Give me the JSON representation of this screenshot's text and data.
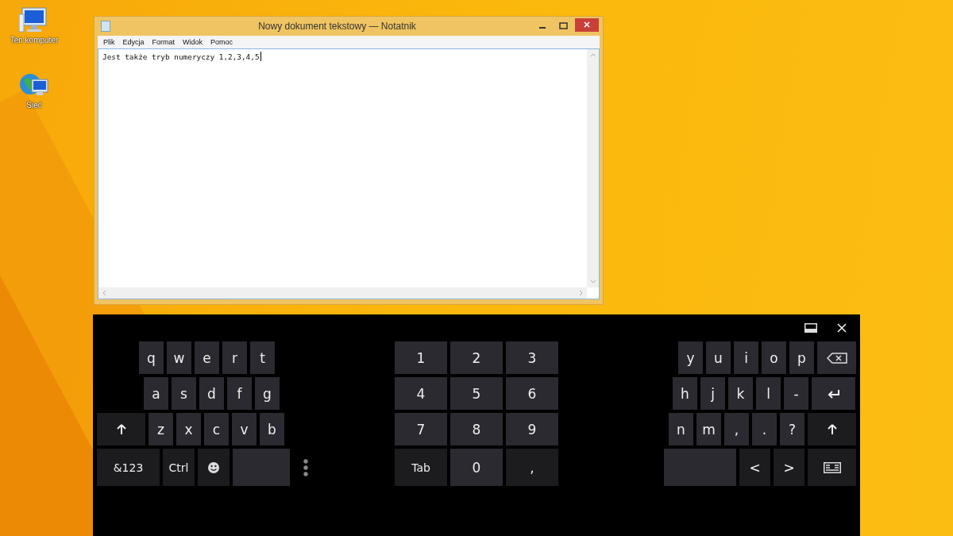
{
  "desktop": {
    "icons": [
      {
        "label": "Ten komputer",
        "kind": "computer"
      },
      {
        "label": "Sieć",
        "kind": "network"
      }
    ]
  },
  "notepad": {
    "title": "Nowy dokument tekstowy — Notatnik",
    "menu": [
      "Plik",
      "Edycja",
      "Format",
      "Widok",
      "Pomoc"
    ],
    "text": "Jest także tryb numeryczy 1,2,3,4,5"
  },
  "keyboard": {
    "sections": [
      {
        "rows": [
          [
            {
              "label": "q",
              "kind": "char"
            },
            {
              "label": "w",
              "kind": "char"
            },
            {
              "label": "e",
              "kind": "char"
            },
            {
              "label": "r",
              "kind": "char"
            },
            {
              "label": "t",
              "kind": "char"
            }
          ],
          [
            {
              "label": "a",
              "kind": "char"
            },
            {
              "label": "s",
              "kind": "char"
            },
            {
              "label": "d",
              "kind": "char"
            },
            {
              "label": "f",
              "kind": "char"
            },
            {
              "label": "g",
              "kind": "char"
            }
          ],
          [
            {
              "kind": "shift"
            },
            {
              "label": "z",
              "kind": "char"
            },
            {
              "label": "x",
              "kind": "char"
            },
            {
              "label": "c",
              "kind": "char"
            },
            {
              "label": "v",
              "kind": "char"
            },
            {
              "label": "b",
              "kind": "char"
            }
          ],
          [
            {
              "label": "&123",
              "kind": "func"
            },
            {
              "label": "Ctrl",
              "kind": "func"
            },
            {
              "kind": "emoji"
            },
            {
              "kind": "space"
            }
          ]
        ]
      },
      {
        "rows": [
          [
            {
              "label": "1",
              "kind": "char"
            },
            {
              "label": "2",
              "kind": "char"
            },
            {
              "label": "3",
              "kind": "char"
            }
          ],
          [
            {
              "label": "4",
              "kind": "char"
            },
            {
              "label": "5",
              "kind": "char"
            },
            {
              "label": "6",
              "kind": "char"
            }
          ],
          [
            {
              "label": "7",
              "kind": "char"
            },
            {
              "label": "8",
              "kind": "char"
            },
            {
              "label": "9",
              "kind": "char"
            }
          ],
          [
            {
              "label": "Tab",
              "kind": "func"
            },
            {
              "label": "0",
              "kind": "char"
            },
            {
              "label": ",",
              "kind": "func"
            }
          ]
        ]
      },
      {
        "rows": [
          [
            {
              "label": "y",
              "kind": "char"
            },
            {
              "label": "u",
              "kind": "char"
            },
            {
              "label": "i",
              "kind": "char"
            },
            {
              "label": "o",
              "kind": "char"
            },
            {
              "label": "p",
              "kind": "char"
            },
            {
              "kind": "backspace"
            }
          ],
          [
            {
              "label": "h",
              "kind": "char"
            },
            {
              "label": "j",
              "kind": "char"
            },
            {
              "label": "k",
              "kind": "char"
            },
            {
              "label": "l",
              "kind": "char"
            },
            {
              "label": "-",
              "kind": "char"
            },
            {
              "kind": "enter"
            }
          ],
          [
            {
              "label": "n",
              "kind": "char"
            },
            {
              "label": "m",
              "kind": "char"
            },
            {
              "label": ",",
              "kind": "char"
            },
            {
              "label": ".",
              "kind": "char"
            },
            {
              "label": "?",
              "kind": "char"
            },
            {
              "kind": "shift"
            }
          ],
          [
            {
              "kind": "space"
            },
            {
              "label": "<",
              "kind": "func"
            },
            {
              "label": ">",
              "kind": "func"
            },
            {
              "kind": "layout"
            }
          ]
        ]
      }
    ]
  }
}
